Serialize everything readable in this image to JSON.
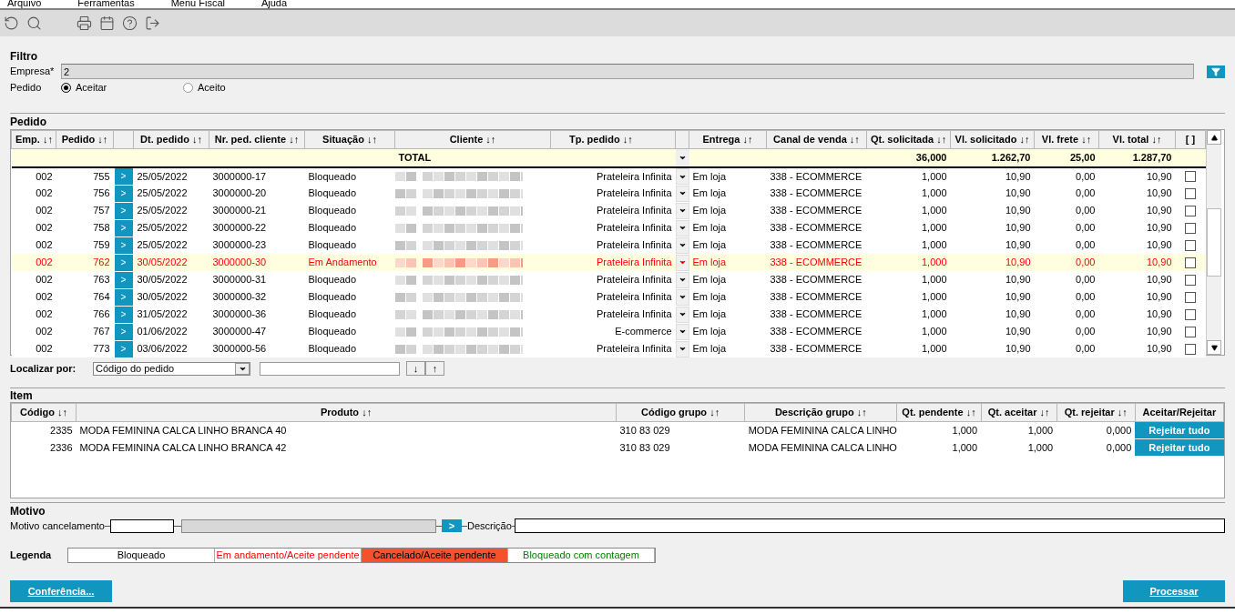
{
  "menu": [
    "Arquivo",
    "Ferramentas",
    "Menu Fiscal",
    "Ajuda"
  ],
  "filter": {
    "title": "Filtro",
    "empresa_label": "Empresa*",
    "empresa_value": "2",
    "pedido_label": "Pedido",
    "options": [
      {
        "label": "Aceitar",
        "selected": true
      },
      {
        "label": "Aceito",
        "selected": false
      }
    ]
  },
  "orders": {
    "title": "Pedido",
    "columns": [
      "Emp. ↓↑",
      "Pedido ↓↑",
      "Dt. pedido ↓↑",
      "Nr. ped. cliente ↓↑",
      "Situação ↓↑",
      "Cliente ↓↑",
      "Tp. pedido ↓↑",
      "Entrega ↓↑",
      "Canal de venda ↓↑",
      "Qt. solicitada ↓↑",
      "Vl. solicitado ↓↑",
      "Vl. frete ↓↑",
      "Vl. total ↓↑",
      "[ ]"
    ],
    "total": {
      "label": "TOTAL",
      "qt": "36,000",
      "vl": "1.262,70",
      "frete": "25,00",
      "total": "1.287,70"
    },
    "rows": [
      {
        "emp": "002",
        "pedido": "755",
        "button": ">",
        "dt": "25/05/2022",
        "nr": "3000000-17",
        "situacao": "Bloqueado",
        "tp": "Prateleira Infinita",
        "entrega": "Em loja",
        "canal": "338 - ECOMMERCE",
        "qt": "1,000",
        "vl": "10,90",
        "frete": "0,00",
        "total": "10,90",
        "kind": "bloqueado",
        "selected": false,
        "checked": false
      },
      {
        "emp": "002",
        "pedido": "756",
        "button": ">",
        "dt": "25/05/2022",
        "nr": "3000000-20",
        "situacao": "Bloqueado",
        "tp": "Prateleira Infinita",
        "entrega": "Em loja",
        "canal": "338 - ECOMMERCE",
        "qt": "1,000",
        "vl": "10,90",
        "frete": "0,00",
        "total": "10,90",
        "kind": "bloqueado",
        "selected": false,
        "checked": false
      },
      {
        "emp": "002",
        "pedido": "757",
        "button": ">",
        "dt": "25/05/2022",
        "nr": "3000000-21",
        "situacao": "Bloqueado",
        "tp": "Prateleira Infinita",
        "entrega": "Em loja",
        "canal": "338 - ECOMMERCE",
        "qt": "1,000",
        "vl": "10,90",
        "frete": "0,00",
        "total": "10,90",
        "kind": "bloqueado",
        "selected": false,
        "checked": false
      },
      {
        "emp": "002",
        "pedido": "758",
        "button": ">",
        "dt": "25/05/2022",
        "nr": "3000000-22",
        "situacao": "Bloqueado",
        "tp": "Prateleira Infinita",
        "entrega": "Em loja",
        "canal": "338 - ECOMMERCE",
        "qt": "1,000",
        "vl": "10,90",
        "frete": "0,00",
        "total": "10,90",
        "kind": "bloqueado",
        "selected": false,
        "checked": false
      },
      {
        "emp": "002",
        "pedido": "759",
        "button": ">",
        "dt": "25/05/2022",
        "nr": "3000000-23",
        "situacao": "Bloqueado",
        "tp": "Prateleira Infinita",
        "entrega": "Em loja",
        "canal": "338 - ECOMMERCE",
        "qt": "1,000",
        "vl": "10,90",
        "frete": "0,00",
        "total": "10,90",
        "kind": "bloqueado",
        "selected": false,
        "checked": false
      },
      {
        "emp": "002",
        "pedido": "762",
        "button": ">",
        "dt": "30/05/2022",
        "nr": "3000000-30",
        "situacao": "Em Andamento",
        "tp": "Prateleira Infinita",
        "entrega": "Em loja",
        "canal": "338 - ECOMMERCE",
        "qt": "1,000",
        "vl": "10,90",
        "frete": "0,00",
        "total": "10,90",
        "kind": "andamento",
        "selected": true,
        "checked": false
      },
      {
        "emp": "002",
        "pedido": "763",
        "button": ">",
        "dt": "30/05/2022",
        "nr": "3000000-31",
        "situacao": "Bloqueado",
        "tp": "Prateleira Infinita",
        "entrega": "Em loja",
        "canal": "338 - ECOMMERCE",
        "qt": "1,000",
        "vl": "10,90",
        "frete": "0,00",
        "total": "10,90",
        "kind": "bloqueado",
        "selected": false,
        "checked": false
      },
      {
        "emp": "002",
        "pedido": "764",
        "button": ">",
        "dt": "30/05/2022",
        "nr": "3000000-32",
        "situacao": "Bloqueado",
        "tp": "Prateleira Infinita",
        "entrega": "Em loja",
        "canal": "338 - ECOMMERCE",
        "qt": "1,000",
        "vl": "10,90",
        "frete": "0,00",
        "total": "10,90",
        "kind": "bloqueado",
        "selected": false,
        "checked": false
      },
      {
        "emp": "002",
        "pedido": "766",
        "button": ">",
        "dt": "31/05/2022",
        "nr": "3000000-36",
        "situacao": "Bloqueado",
        "tp": "Prateleira Infinita",
        "entrega": "Em loja",
        "canal": "338 - ECOMMERCE",
        "qt": "1,000",
        "vl": "10,90",
        "frete": "0,00",
        "total": "10,90",
        "kind": "bloqueado",
        "selected": false,
        "checked": false
      },
      {
        "emp": "002",
        "pedido": "767",
        "button": ">",
        "dt": "01/06/2022",
        "nr": "3000000-47",
        "situacao": "Bloqueado",
        "tp": "E-commerce",
        "entrega": "Em loja",
        "canal": "338 - ECOMMERCE",
        "qt": "1,000",
        "vl": "10,90",
        "frete": "0,00",
        "total": "10,90",
        "kind": "bloqueado",
        "selected": false,
        "checked": false
      },
      {
        "emp": "002",
        "pedido": "773",
        "button": ">",
        "dt": "03/06/2022",
        "nr": "3000000-56",
        "situacao": "Bloqueado",
        "tp": "Prateleira Infinita",
        "entrega": "Em loja",
        "canal": "338 - ECOMMERCE",
        "qt": "1,000",
        "vl": "10,90",
        "frete": "0,00",
        "total": "10,90",
        "kind": "bloqueado",
        "selected": false,
        "checked": false
      }
    ]
  },
  "locate": {
    "label": "Localizar por:",
    "select_value": "Código do pedido",
    "buttons": [
      "↓",
      "↑"
    ]
  },
  "items": {
    "title": "Item",
    "columns": [
      "Código ↓↑",
      "Produto ↓↑",
      "Código grupo ↓↑",
      "Descrição grupo ↓↑",
      "Qt. pendente ↓↑",
      "Qt. aceitar ↓↑",
      "Qt. rejeitar ↓↑",
      "Aceitar/Rejeitar"
    ],
    "rows": [
      {
        "codigo": "2335",
        "produto": "MODA FEMININA CALCA LINHO BRANCA 40",
        "grupo": "310 83 029",
        "descricao": "MODA FEMININA CALCA LINHO",
        "pendente": "1,000",
        "aceitar": "1,000",
        "rejeitar": "0,000",
        "action": "Rejeitar tudo"
      },
      {
        "codigo": "2336",
        "produto": "MODA FEMININA CALCA LINHO BRANCA 42",
        "grupo": "310 83 029",
        "descricao": "MODA FEMININA CALCA LINHO",
        "pendente": "1,000",
        "aceitar": "1,000",
        "rejeitar": "0,000",
        "action": "Rejeitar tudo"
      }
    ]
  },
  "motivo": {
    "title": "Motivo",
    "cancel_label": "Motivo cancelamento",
    "go_button": ">",
    "description_label": "Descrição"
  },
  "legend": {
    "label": "Legenda",
    "items": [
      {
        "label": "Bloqueado",
        "kind": "bloqueado"
      },
      {
        "label": "Em andamento/Aceite pendente",
        "kind": "andamento"
      },
      {
        "label": "Cancelado/Aceite pendente",
        "kind": "cancelado"
      },
      {
        "label": "Bloqueado com contagem",
        "kind": "contagem"
      }
    ]
  },
  "buttons": {
    "left": "Conferência...",
    "right": "Processar"
  }
}
